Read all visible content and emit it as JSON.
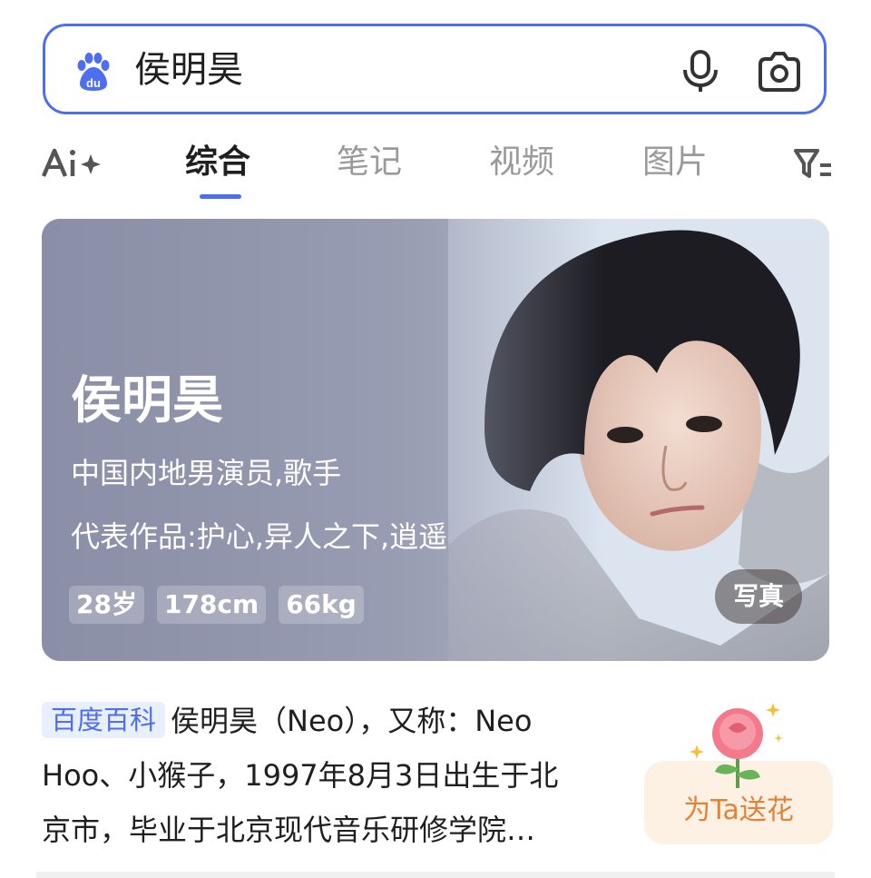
{
  "search": {
    "query": "侯明昊"
  },
  "tabs": [
    {
      "label": "综合",
      "active": true
    },
    {
      "label": "笔记"
    },
    {
      "label": "视频"
    },
    {
      "label": "图片"
    }
  ],
  "hero": {
    "name": "侯明昊",
    "subtitle": "中国内地男演员,歌手",
    "works": "代表作品:护心,异人之下,逍遥",
    "chips": [
      "28岁",
      "178cm",
      "66kg"
    ],
    "photo_button": "写真"
  },
  "baike": {
    "tag": "百度百科",
    "line1": "侯明昊（Neo），又称：Neo",
    "line2": "Hoo、小猴子，1997年8月3日出生于北",
    "line3": "京市，毕业于北京现代音乐研修学院…"
  },
  "flower": {
    "label": "为Ta送花"
  },
  "colors": {
    "accent": "#4e6ef2",
    "flower_text": "#e2823a"
  }
}
